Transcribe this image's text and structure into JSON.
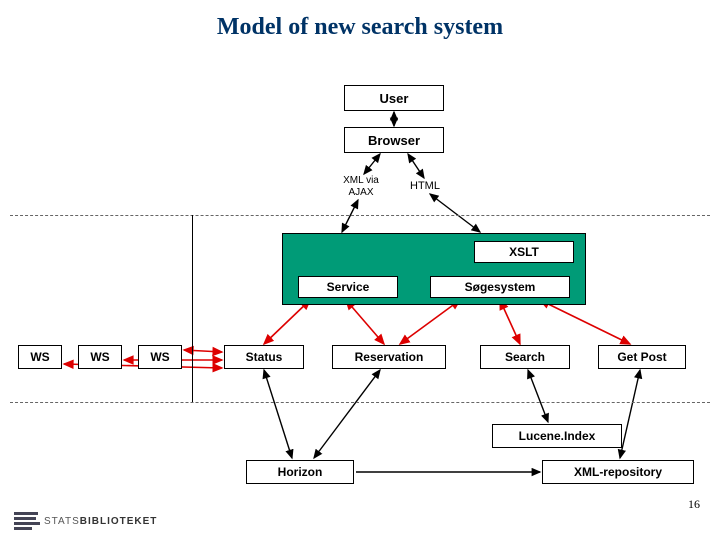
{
  "title": "Model of new search system",
  "user": "User",
  "browser": "Browser",
  "left_label_line1": "XML via",
  "left_label_line2": "AJAX",
  "right_label": "HTML",
  "xslt": "XSLT",
  "service": "Service",
  "sogesystem": "Søgesystem",
  "ws1": "WS",
  "ws2": "WS",
  "ws3": "WS",
  "status": "Status",
  "reservation": "Reservation",
  "search": "Search",
  "getpost": "Get Post",
  "lucene": "Lucene.Index",
  "horizon": "Horizon",
  "xmlrepo": "XML-repository",
  "page_num": "16",
  "logo_thin": "STATS",
  "logo_bold": "BIBLIOTEKET"
}
